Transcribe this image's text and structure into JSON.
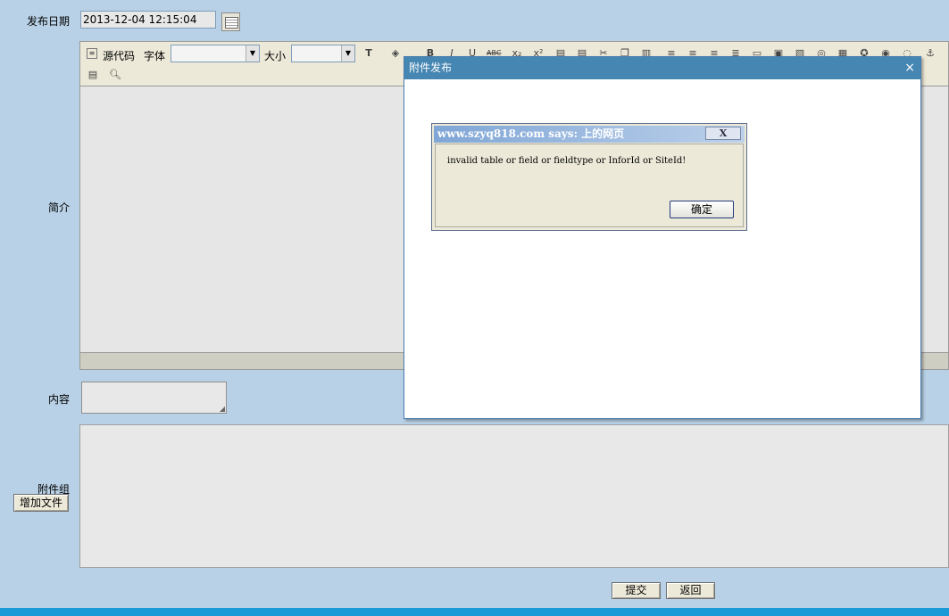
{
  "form": {
    "publish_date_label": "发布日期",
    "publish_date_value": "2013-12-04 12:15:04",
    "summary_label": "简介",
    "content_label": "内容",
    "attachments_label": "附件组",
    "add_file_button": "增加文件",
    "submit_button": "提交",
    "back_button": "返回"
  },
  "editor_toolbar": {
    "source_code": "源代码",
    "font_label": "字体",
    "size_label": "大小",
    "font_value": "",
    "size_value": "",
    "icons": [
      "text-color-icon",
      "bg-color-icon",
      "bold-icon",
      "italic-icon",
      "underline-icon",
      "strikethrough-icon",
      "subscript-icon",
      "superscript-icon",
      "paste-icon",
      "paste-word-icon",
      "cut-icon",
      "copy-icon",
      "paste-text-icon",
      "align-left-icon",
      "align-center-icon",
      "align-right-icon",
      "justify-icon",
      "horizontal-rule-icon",
      "image-icon",
      "flash-icon",
      "media-icon",
      "table-icon",
      "special-char-icon",
      "link-icon",
      "unlink-icon",
      "anchor-icon",
      "show-blocks-icon",
      "preview-icon"
    ]
  },
  "attach_dialog": {
    "title": "附件发布",
    "close": "×"
  },
  "alert": {
    "title": "www.szyq818.com says: 上的网页",
    "close": "X",
    "message": "invalid table or field or fieldtype or InforId or SiteId!",
    "ok_button": "确定"
  },
  "colors": {
    "page_bg": "#b9d1e6",
    "dialog_title_bg": "#4686b2",
    "bottom_bar": "#1a9bd8"
  }
}
